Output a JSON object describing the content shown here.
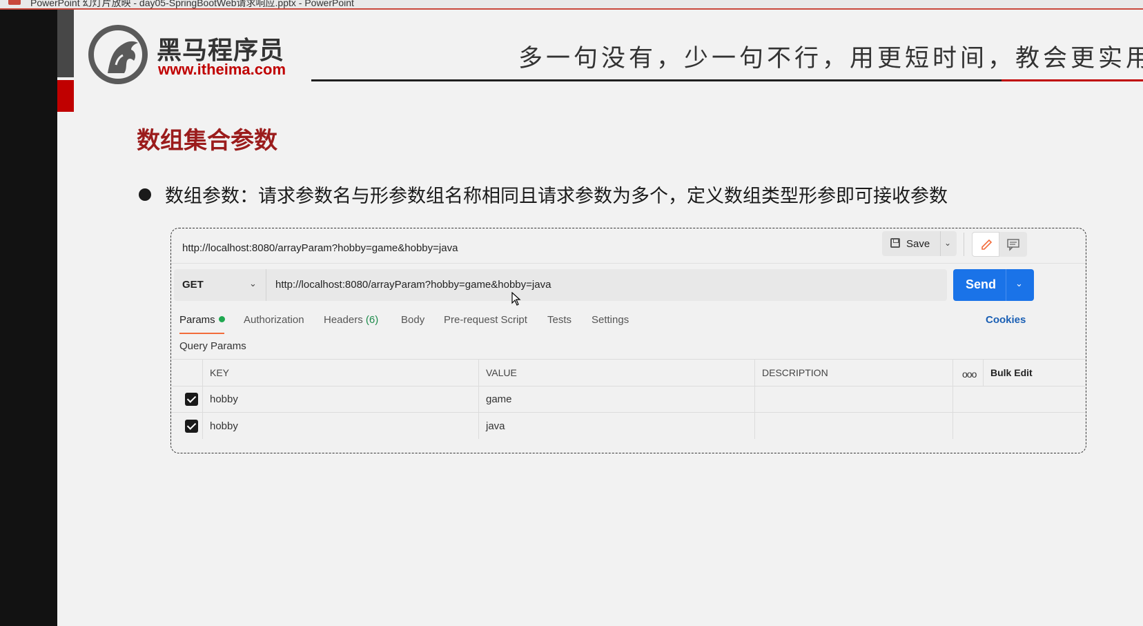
{
  "window": {
    "title": "PowerPoint 幻灯片放映 - day05-SpringBootWeb请求响应.pptx - PowerPoint"
  },
  "brand": {
    "name_cn": "黑马程序员",
    "url": "www.itheima.com"
  },
  "slogan": "多一句没有，少一句不行，用更短时间，教会更实用的",
  "heading": "数组集合参数",
  "bullet": "数组参数：请求参数名与形参数组名称相同且请求参数为多个，定义数组类型形参即可接收参数",
  "colors": {
    "accent_red": "#c00000",
    "send_blue": "#1a73e8",
    "tab_underline": "#f26b3a",
    "params_dot": "#1fa850"
  },
  "postman": {
    "title_url": "http://localhost:8080/arrayParam?hobby=game&hobby=java",
    "save_label": "Save",
    "method": "GET",
    "request_url": "http://localhost:8080/arrayParam?hobby=game&hobby=java",
    "send_label": "Send",
    "tabs": [
      {
        "label": "Params"
      },
      {
        "label": "Authorization"
      },
      {
        "label": "Headers",
        "count": "(6)"
      },
      {
        "label": "Body"
      },
      {
        "label": "Pre-request Script"
      },
      {
        "label": "Tests"
      },
      {
        "label": "Settings"
      }
    ],
    "cookies_label": "Cookies",
    "query_params_label": "Query Params",
    "table": {
      "headers": {
        "key": "KEY",
        "value": "VALUE",
        "description": "DESCRIPTION",
        "more": "ooo",
        "bulk_edit": "Bulk Edit"
      },
      "rows": [
        {
          "checked": true,
          "key": "hobby",
          "value": "game",
          "description": ""
        },
        {
          "checked": true,
          "key": "hobby",
          "value": "java",
          "description": ""
        }
      ]
    }
  }
}
